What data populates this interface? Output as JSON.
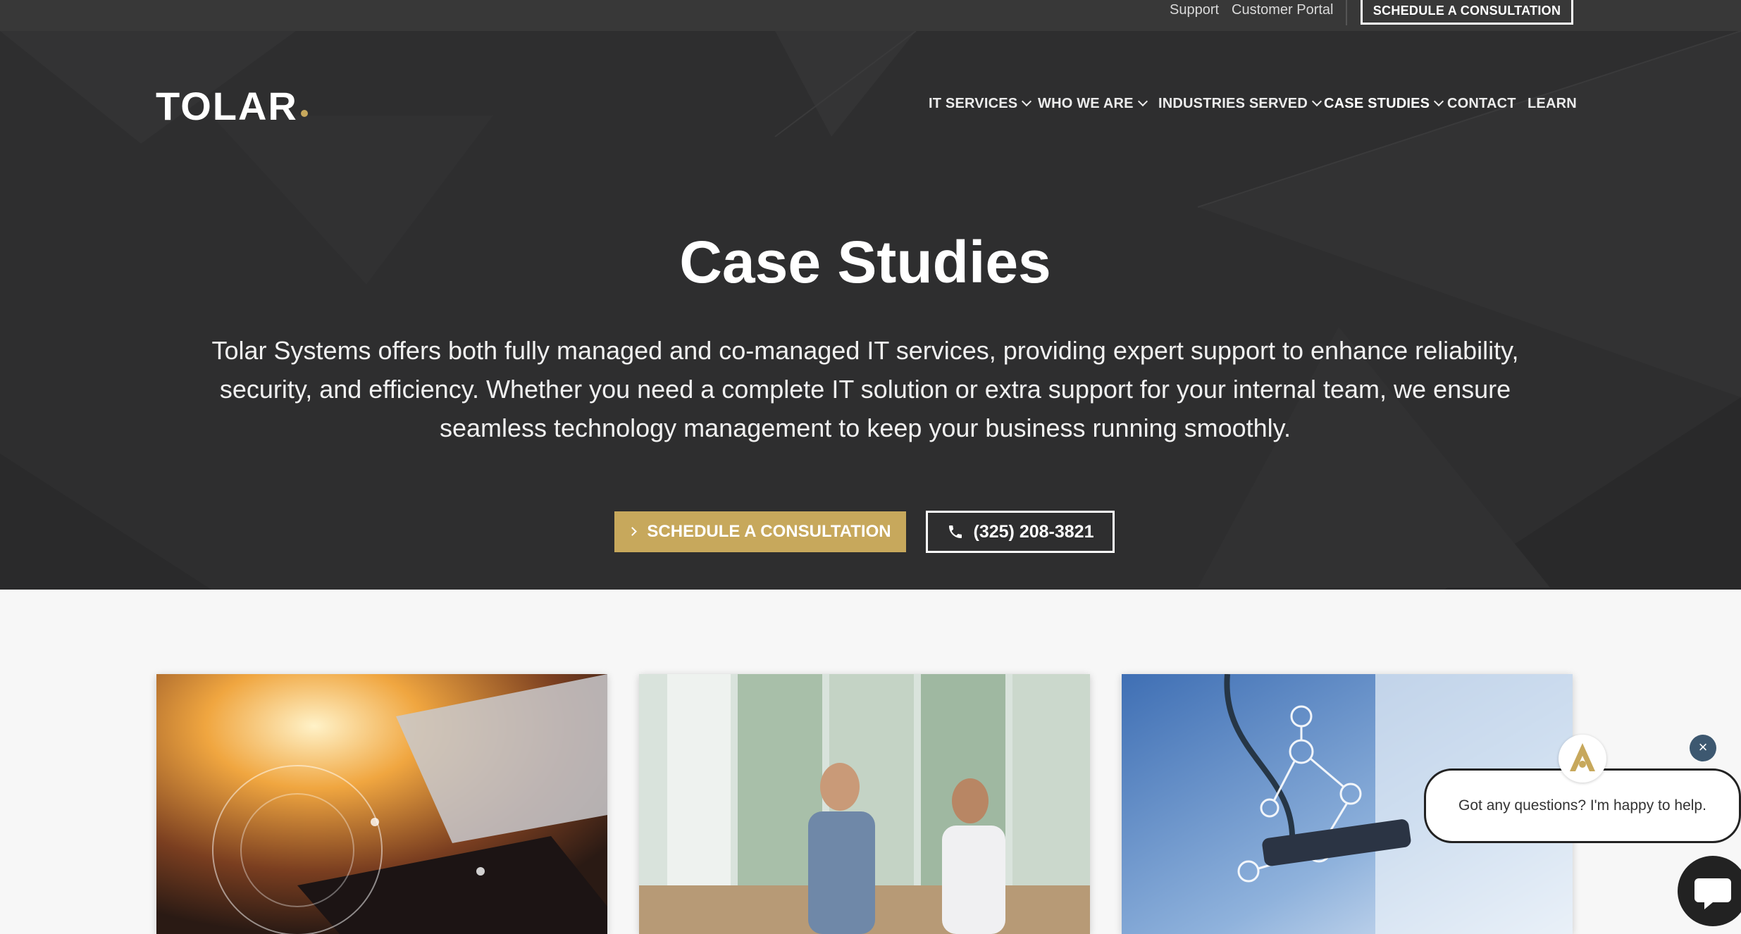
{
  "topbar": {
    "support_label": "Support",
    "portal_label": "Customer Portal",
    "cta_label": "SCHEDULE A CONSULTATION"
  },
  "brand": {
    "logo_text": "TOLAR",
    "accent": "#c7a85c"
  },
  "nav": {
    "items": [
      {
        "label": "IT SERVICES",
        "has_dropdown": true
      },
      {
        "label": "WHO WE ARE",
        "has_dropdown": true
      },
      {
        "label": "INDUSTRIES SERVED",
        "has_dropdown": true
      },
      {
        "label": "CASE STUDIES",
        "has_dropdown": true,
        "active": true
      },
      {
        "label": "CONTACT",
        "has_dropdown": false
      },
      {
        "label": "LEARN",
        "has_dropdown": false
      }
    ]
  },
  "hero": {
    "title": "Case Studies",
    "description": "Tolar Systems offers both fully managed and co-managed IT services, providing expert support to enhance reliability, security, and efficiency. Whether you need a complete IT solution or extra support for your internal team, we ensure seamless technology management to keep your business running smoothly.",
    "schedule_label": "SCHEDULE A CONSULTATION",
    "phone_label": "(325) 208-3821"
  },
  "cards": [
    {
      "image": "laptop-tablet-technology-photo"
    },
    {
      "image": "office-meeting-photo"
    },
    {
      "image": "healthcare-doctor-photo"
    }
  ],
  "chat": {
    "message": "Got any questions? I'm happy to help.",
    "close_label": "×"
  },
  "colors": {
    "hero_bg": "#2e2e2f",
    "topbar_bg": "#383838",
    "gold": "#c7a85c",
    "page_bg": "#f7f7f7"
  }
}
